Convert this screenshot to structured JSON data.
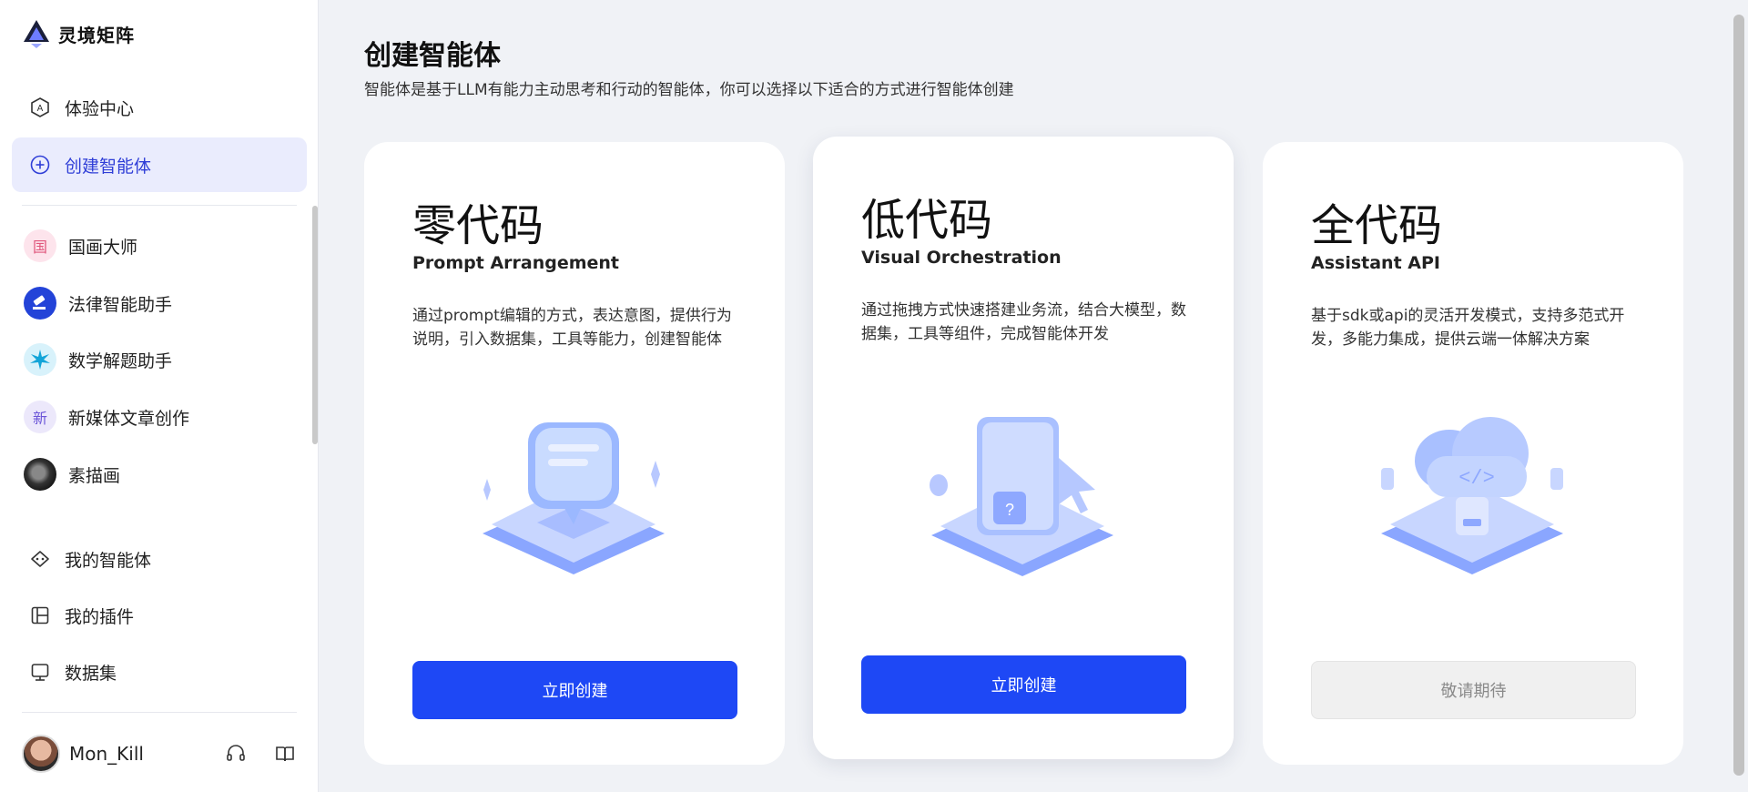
{
  "brand": {
    "name": "灵境矩阵"
  },
  "sidebar": {
    "nav": [
      {
        "label": "体验中心",
        "icon": "compass-icon"
      },
      {
        "label": "创建智能体",
        "icon": "plus-circle-icon"
      }
    ],
    "agents": [
      {
        "label": "国画大师",
        "avatar_text": "国"
      },
      {
        "label": "法律智能助手",
        "avatar_text": ""
      },
      {
        "label": "数学解题助手",
        "avatar_text": ""
      },
      {
        "label": "新媒体文章创作",
        "avatar_text": "新"
      },
      {
        "label": "素描画",
        "avatar_text": ""
      }
    ],
    "bottom_nav": [
      {
        "label": "我的智能体",
        "icon": "robot-icon"
      },
      {
        "label": "我的插件",
        "icon": "plugin-icon"
      },
      {
        "label": "数据集",
        "icon": "dataset-icon"
      }
    ],
    "user": {
      "name": "Mon_Kill"
    }
  },
  "main": {
    "title": "创建智能体",
    "subtitle": "智能体是基于LLM有能力主动思考和行动的智能体，你可以选择以下适合的方式进行智能体创建",
    "cards": [
      {
        "title": "零代码",
        "subtitle": "Prompt Arrangement",
        "description": "通过prompt编辑的方式，表达意图，提供行为说明，引入数据集，工具等能力，创建智能体",
        "button": "立即创建",
        "enabled": true
      },
      {
        "title": "低代码",
        "subtitle": "Visual Orchestration",
        "description": "通过拖拽方式快速搭建业务流，结合大模型，数据集，工具等组件，完成智能体开发",
        "button": "立即创建",
        "enabled": true
      },
      {
        "title": "全代码",
        "subtitle": "Assistant API",
        "description": "基于sdk或api的灵活开发模式，支持多范式开发，多能力集成，提供云端一体解决方案",
        "button": "敬请期待",
        "enabled": false
      }
    ]
  },
  "colors": {
    "primary": "#1e48f5",
    "active_bg": "#eaecfd",
    "active_text": "#2f3ed7"
  }
}
